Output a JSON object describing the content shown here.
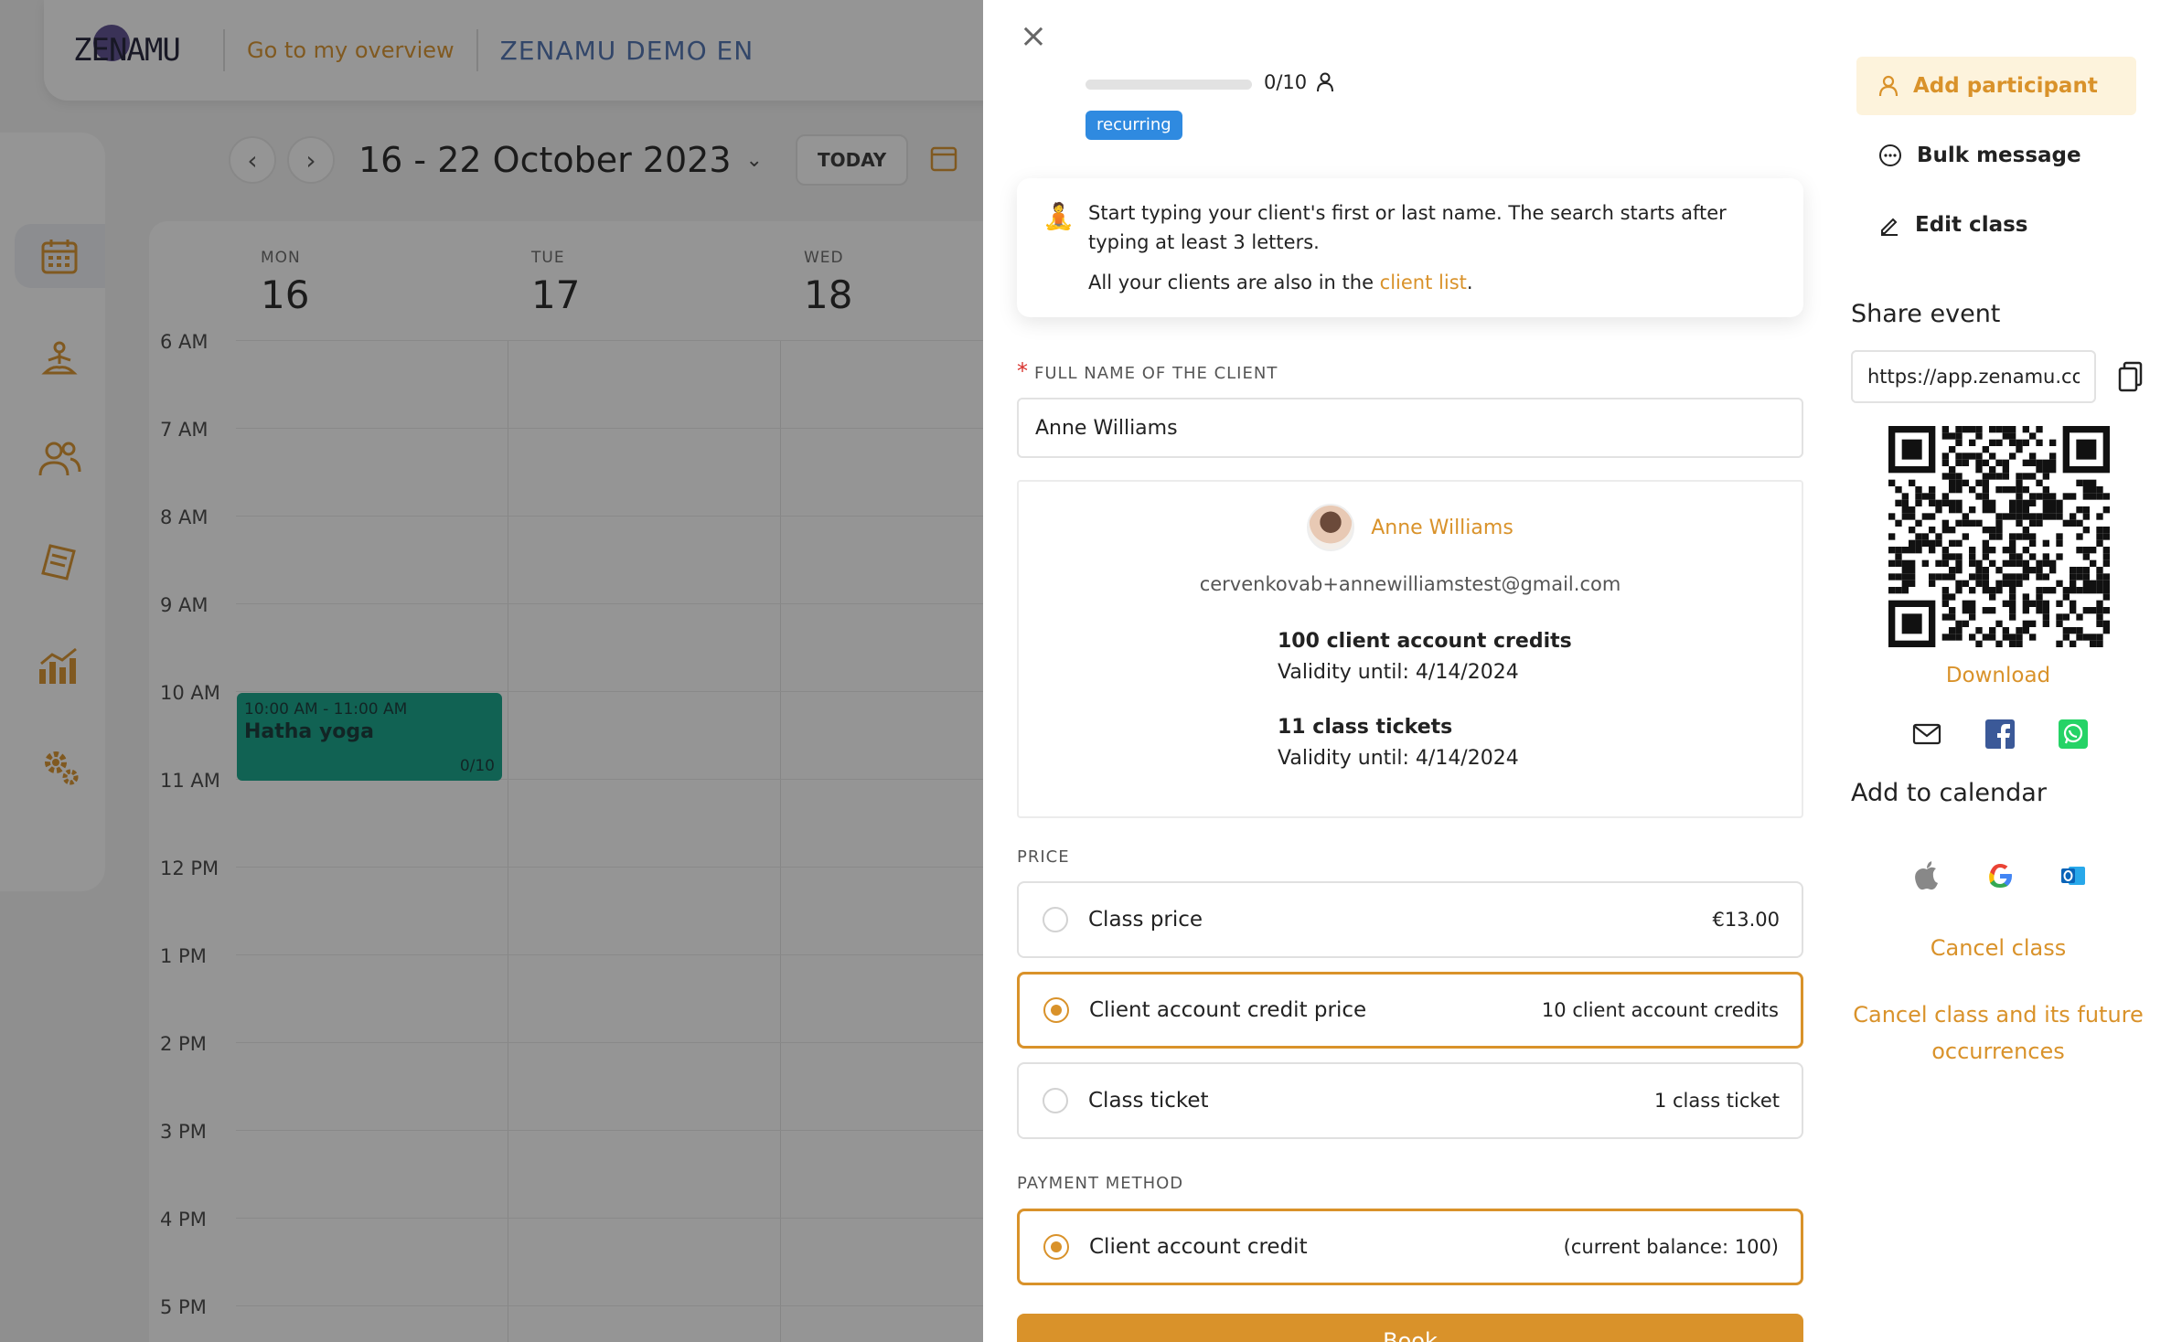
{
  "header": {
    "logo": "ZENAMU",
    "overview_link": "Go to my overview",
    "studio_name": "ZENAMU DEMO EN"
  },
  "toolbar": {
    "prev_icon": "chevron-left-icon",
    "next_icon": "chevron-right-icon",
    "date_range": "16 - 22 October 2023",
    "today_label": "TODAY"
  },
  "sidebar": {
    "items": [
      {
        "icon": "calendar-icon",
        "active": true
      },
      {
        "icon": "yoga-icon"
      },
      {
        "icon": "users-icon"
      },
      {
        "icon": "ticket-icon"
      },
      {
        "icon": "chart-icon"
      },
      {
        "icon": "gear-icon"
      }
    ]
  },
  "calendar": {
    "days": [
      {
        "name": "MON",
        "date": "16"
      },
      {
        "name": "TUE",
        "date": "17"
      },
      {
        "name": "WED",
        "date": "18"
      }
    ],
    "hours": [
      "6 AM",
      "7 AM",
      "8 AM",
      "9 AM",
      "10 AM",
      "11 AM",
      "12 PM",
      "1 PM",
      "2 PM",
      "3 PM",
      "4 PM",
      "5 PM"
    ],
    "event": {
      "time": "10:00 AM - 11:00 AM",
      "name": "Hatha yoga",
      "capacity": "0/10",
      "color": "#0fa287"
    }
  },
  "drawer": {
    "capacity_text": "0/10",
    "recurring_badge": "recurring",
    "info": {
      "line1": "Start typing your client's first or last name. The search starts after typing at least 3 letters.",
      "line2_prefix": "All your clients are also in the ",
      "line2_link": "client list",
      "line2_suffix": "."
    },
    "client_field_label": "FULL NAME OF THE CLIENT",
    "client_field_value": "Anne Williams",
    "client": {
      "name": "Anne Williams",
      "email": "cervenkovab+annewilliamstest@gmail.com",
      "credits_title": "100 client account credits",
      "credits_validity": "Validity until: 4/14/2024",
      "tickets_title": "11 class tickets",
      "tickets_validity": "Validity until: 4/14/2024"
    },
    "price_label": "PRICE",
    "price_options": [
      {
        "label": "Class price",
        "value": "€13.00",
        "selected": false
      },
      {
        "label": "Client account credit price",
        "value": "10 client account credits",
        "selected": true
      },
      {
        "label": "Class ticket",
        "value": "1 class ticket",
        "selected": false
      }
    ],
    "payment_label": "PAYMENT METHOD",
    "payment_option": {
      "label": "Client account credit",
      "value": "(current balance: 100)",
      "selected": true
    },
    "book_label": "Book"
  },
  "actions": {
    "add_participant": "Add participant",
    "bulk_message": "Bulk message",
    "edit_class": "Edit class"
  },
  "share": {
    "title": "Share event",
    "url": "https://app.zenamu.co",
    "download": "Download",
    "add_to_calendar": "Add to calendar",
    "cancel_class": "Cancel class",
    "cancel_future": "Cancel class and its future occurrences"
  },
  "colors": {
    "accent": "#d9922a",
    "badge": "#2f8ae0",
    "event": "#0fa287"
  }
}
